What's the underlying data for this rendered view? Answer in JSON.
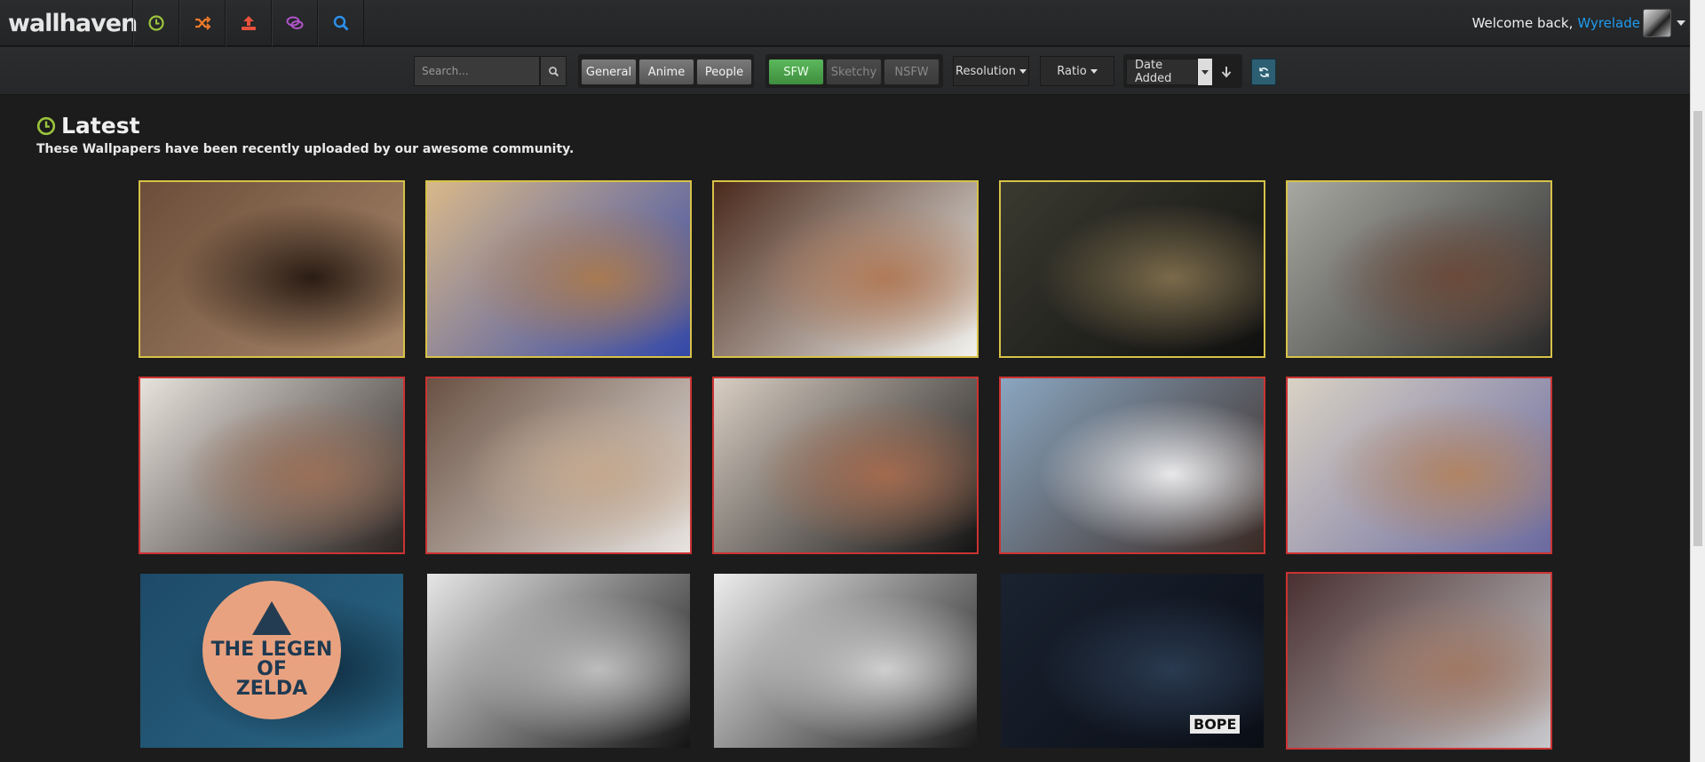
{
  "header": {
    "logo": "wallhaven",
    "nav_icons": [
      {
        "name": "latest-icon",
        "color": "#9bc43c"
      },
      {
        "name": "random-icon",
        "color": "#f07a2a"
      },
      {
        "name": "upload-icon",
        "color": "#e8523c"
      },
      {
        "name": "forums-icon",
        "color": "#b054c8"
      },
      {
        "name": "search-icon",
        "color": "#2c8ee8"
      }
    ],
    "welcome_text": "Welcome back,",
    "username": "Wyrelade"
  },
  "searchbar": {
    "search_placeholder": "Search...",
    "categories": [
      "General",
      "Anime",
      "People"
    ],
    "purity": [
      "SFW",
      "Sketchy",
      "NSFW"
    ],
    "resolution_label": "Resolution",
    "ratio_label": "Ratio",
    "sort_label": "Date Added"
  },
  "page": {
    "title": "Latest",
    "subtitle": "These Wallpapers have been recently uploaded by our awesome community."
  },
  "thumbnails": [
    {
      "purity": "sketchy",
      "colors": [
        "#6b4e3a",
        "#2a1c14",
        "#a8876a"
      ]
    },
    {
      "purity": "sketchy",
      "colors": [
        "#d9b98a",
        "#a77a52",
        "#3448a8"
      ]
    },
    {
      "purity": "sketchy",
      "colors": [
        "#4a2a1c",
        "#b07a58",
        "#f2f2ee"
      ]
    },
    {
      "purity": "sketchy",
      "colors": [
        "#3a3a30",
        "#7a6a4a",
        "#101010"
      ]
    },
    {
      "purity": "sketchy",
      "colors": [
        "#a8a8a2",
        "#6a4a3a",
        "#2a2a2a"
      ]
    },
    {
      "purity": "nsfw",
      "colors": [
        "#e8e2dc",
        "#9a7058",
        "#2a2422"
      ]
    },
    {
      "purity": "nsfw",
      "colors": [
        "#6a5244",
        "#c4a88e",
        "#e8e4e0"
      ]
    },
    {
      "purity": "nsfw",
      "colors": [
        "#d8cdc2",
        "#a26a4e",
        "#141414"
      ]
    },
    {
      "purity": "nsfw",
      "colors": [
        "#8aa6c0",
        "#e8e8ea",
        "#3a2a24"
      ]
    },
    {
      "purity": "nsfw",
      "colors": [
        "#d9d2c4",
        "#b08464",
        "#6a6aa0"
      ]
    },
    {
      "purity": "sfw",
      "colors": [
        "#1d4a68",
        "#0e2a3e",
        "#2a6684"
      ],
      "text_lines": [
        "THE LEGEN",
        "OF",
        "ZELDA"
      ]
    },
    {
      "purity": "sfw",
      "colors": [
        "#e6e6e6",
        "#bdbdbd",
        "#141414"
      ]
    },
    {
      "purity": "sfw",
      "colors": [
        "#ededed",
        "#cfcfcf",
        "#1a1a1a"
      ]
    },
    {
      "purity": "sfw",
      "colors": [
        "#1a2230",
        "#2a3a50",
        "#0a0e16"
      ],
      "text": "BOPE"
    },
    {
      "purity": "nsfw",
      "colors": [
        "#4a3030",
        "#a07864",
        "#c8c8cc"
      ]
    }
  ]
}
